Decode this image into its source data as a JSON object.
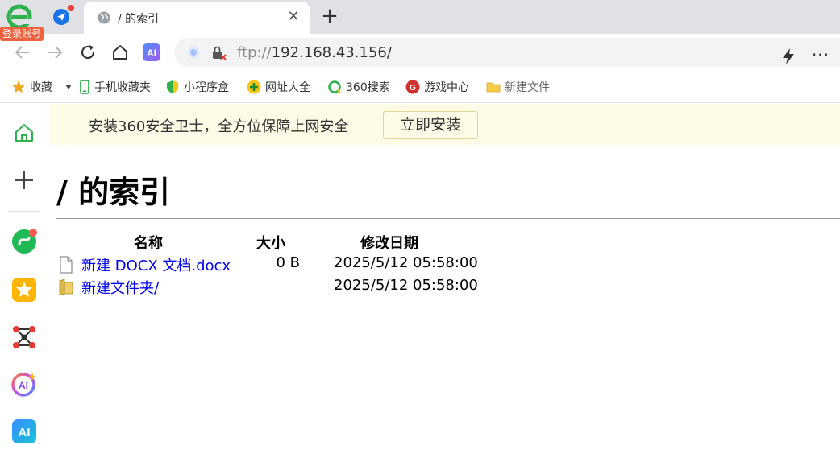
{
  "browser": {
    "login_badge": "登录账号",
    "tab": {
      "title": "/ 的索引",
      "close_glyph": "✕"
    },
    "new_tab_glyph": "+",
    "address": {
      "scheme": "ftp://",
      "host": "192.168.43.156/"
    },
    "more_glyph": "···"
  },
  "bookmarks": [
    {
      "label": "收藏",
      "icon": "star-icon"
    },
    {
      "label": "手机收藏夹",
      "icon": "phone-icon"
    },
    {
      "label": "小程序盒",
      "icon": "shield-icon"
    },
    {
      "label": "网址大全",
      "icon": "plus-circle-icon"
    },
    {
      "label": "360搜索",
      "icon": "search-360-icon"
    },
    {
      "label": "游戏中心",
      "icon": "game-center-icon"
    },
    {
      "label": "新建文件",
      "icon": "folder-icon"
    }
  ],
  "banner": {
    "text": "安装360安全卫士，全方位保障上网安全",
    "button": "立即安装"
  },
  "page": {
    "title": "/ 的索引",
    "columns": {
      "name": "名称",
      "size": "大小",
      "date": "修改日期"
    },
    "rows": [
      {
        "name": "新建 DOCX 文档.docx",
        "size": "0 B",
        "date": "2025/5/12 05:58:00",
        "icon": "file-icon"
      },
      {
        "name": "新建文件夹/",
        "size": "",
        "date": "2025/5/12 05:58:00",
        "icon": "folder-icon"
      }
    ]
  },
  "colors": {
    "link": "#0000ee",
    "banner_bg": "#fefbe6",
    "tabstrip_bg": "#dfe1e5",
    "login_badge": "#f0623f"
  }
}
